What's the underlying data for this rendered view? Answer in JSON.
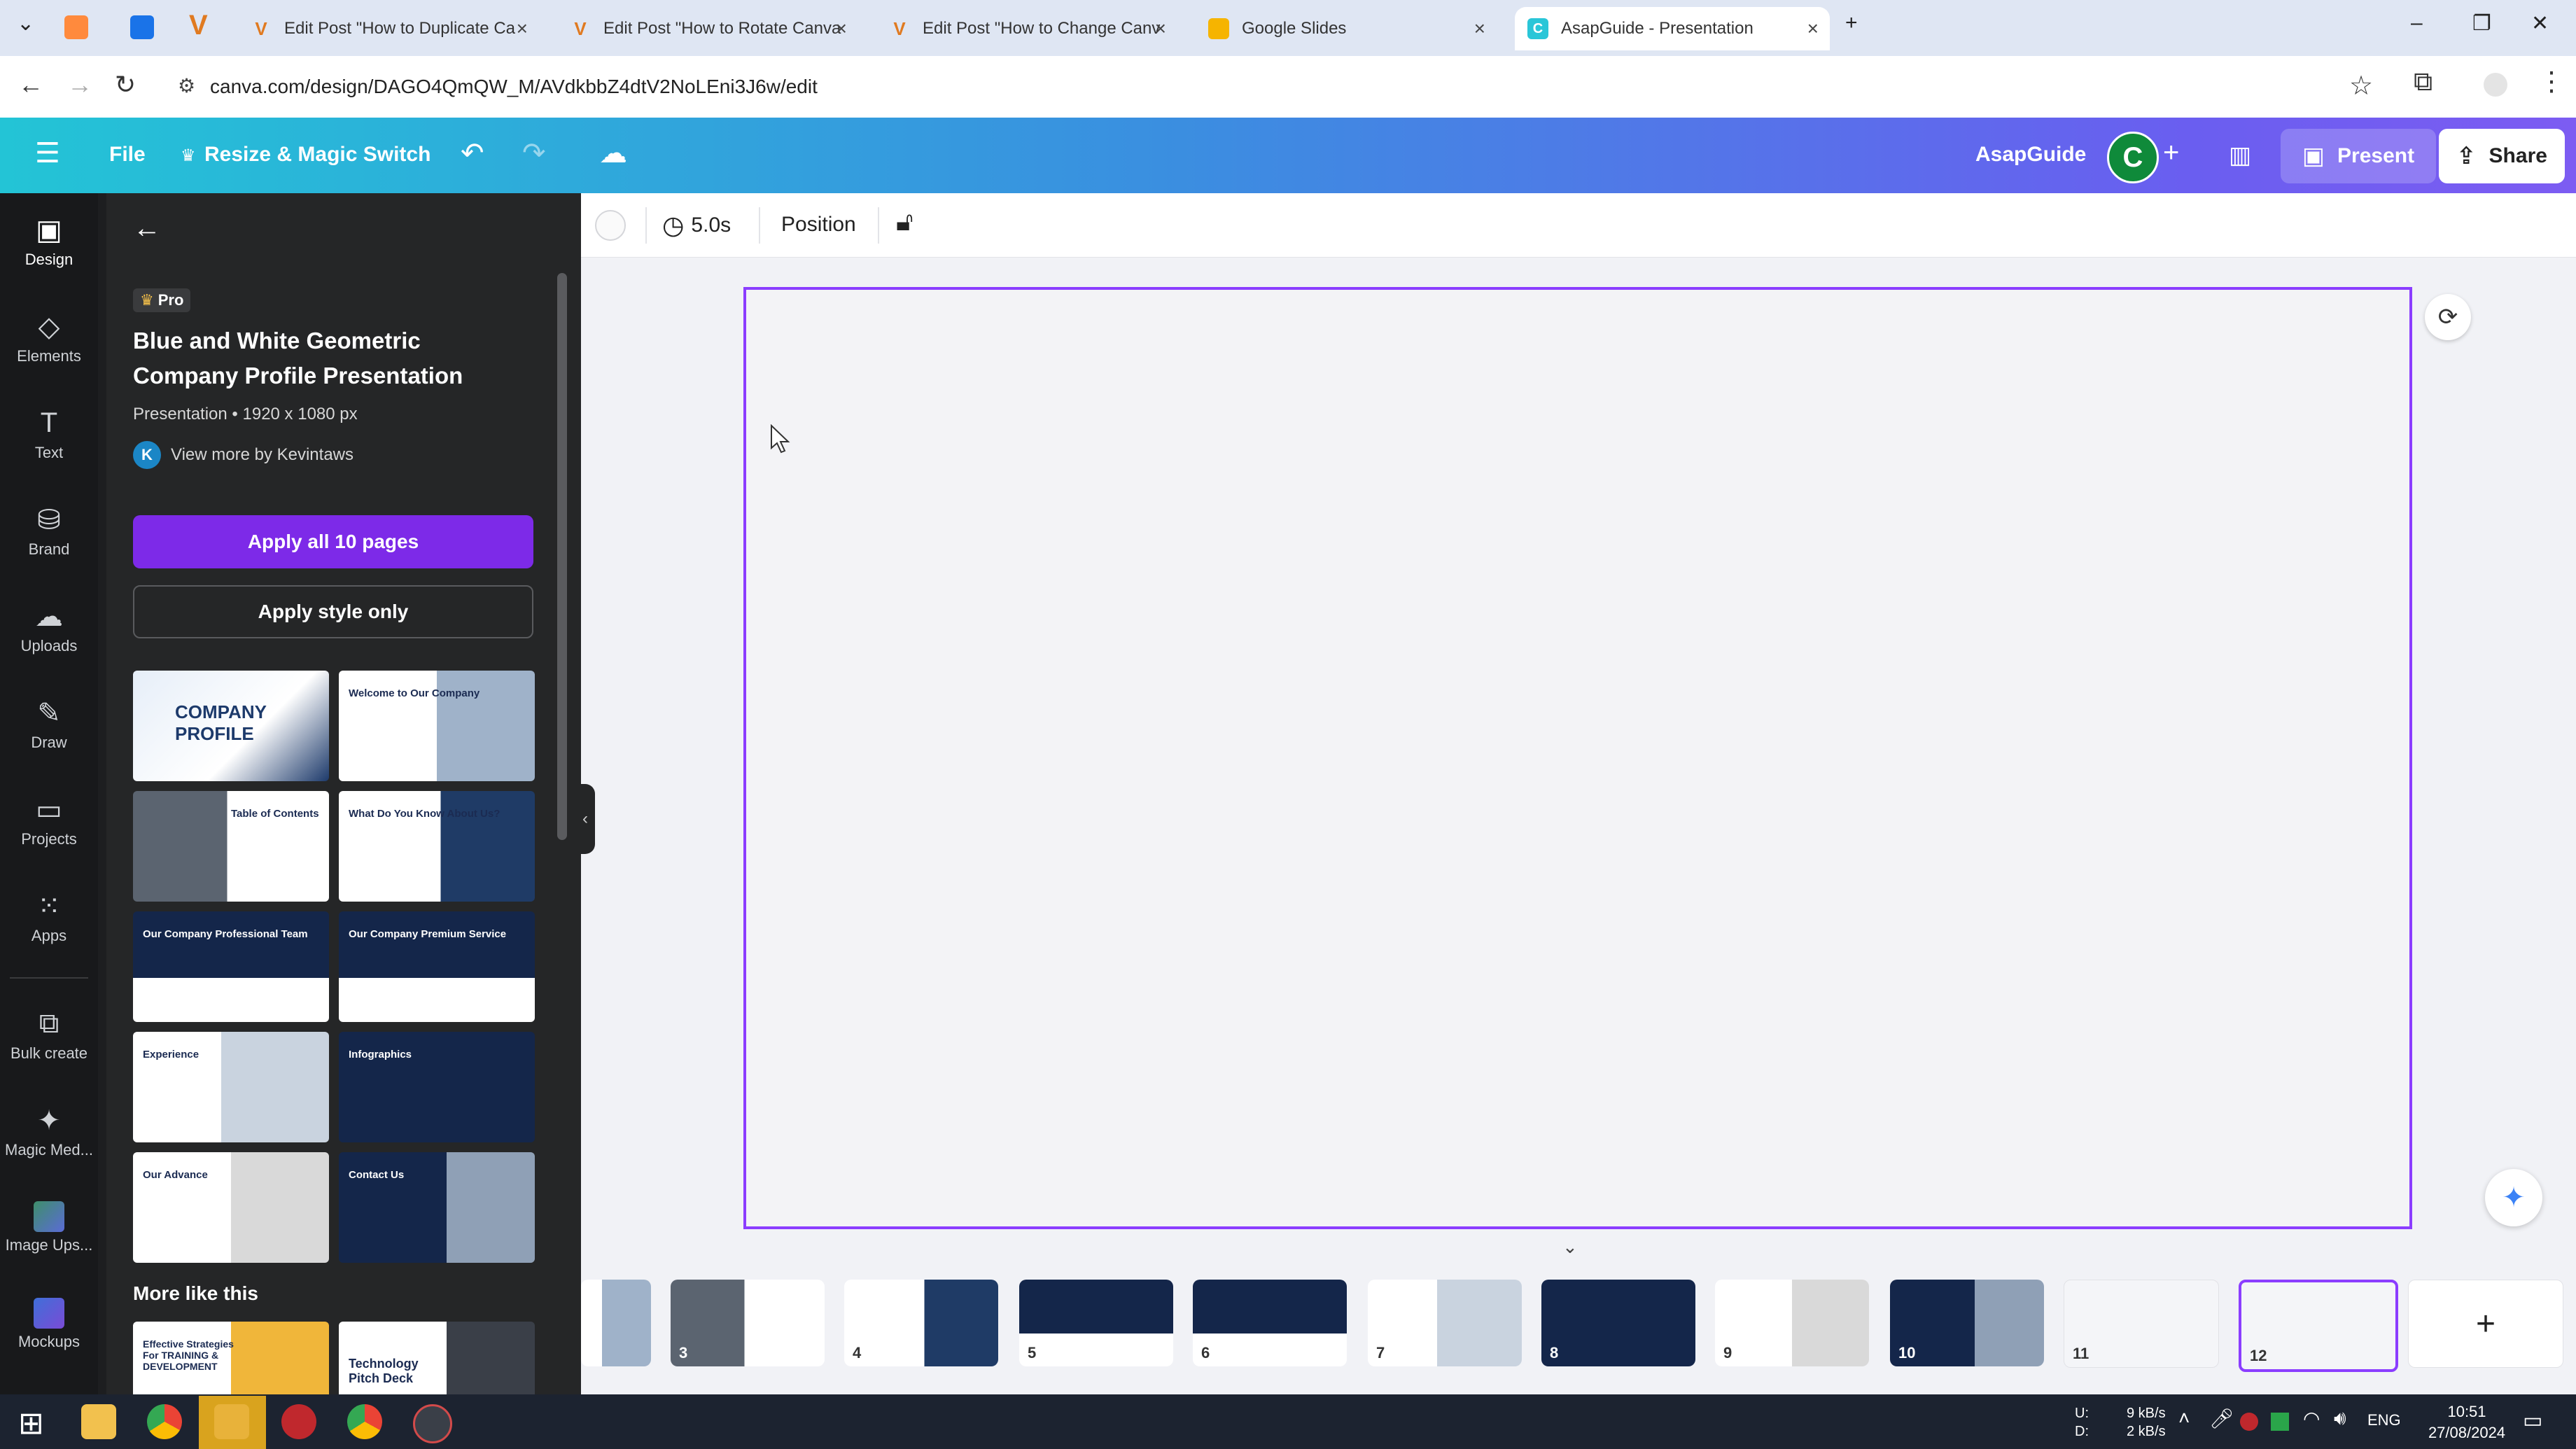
{
  "browser": {
    "tabs": [
      {
        "label": "Edit Post \"How to Duplicate Ca",
        "icon": "v-logo-icon"
      },
      {
        "label": "Edit Post \"How to Rotate Canva",
        "icon": "v-logo-icon"
      },
      {
        "label": "Edit Post \"How to Change Canv",
        "icon": "v-logo-icon"
      },
      {
        "label": "Google Slides",
        "icon": "google-slides-icon"
      },
      {
        "label": "AsapGuide - Presentation",
        "icon": "canva-icon"
      }
    ],
    "url": "canva.com/design/DAGO4QmQW_M/AVdkbbZ4dtV2NoLEni3J6w/edit"
  },
  "topbar": {
    "file_label": "File",
    "resize_label": "Resize & Magic Switch",
    "team_name": "AsapGuide",
    "avatar_letter": "C",
    "present_label": "Present",
    "share_label": "Share"
  },
  "rail": [
    {
      "label": "Design",
      "icon": "design-icon"
    },
    {
      "label": "Elements",
      "icon": "elements-icon"
    },
    {
      "label": "Text",
      "icon": "text-icon"
    },
    {
      "label": "Brand",
      "icon": "brand-icon"
    },
    {
      "label": "Uploads",
      "icon": "uploads-icon"
    },
    {
      "label": "Draw",
      "icon": "draw-icon"
    },
    {
      "label": "Projects",
      "icon": "projects-icon"
    },
    {
      "label": "Apps",
      "icon": "apps-icon"
    },
    {
      "label": "Bulk create",
      "icon": "bulk-create-icon"
    },
    {
      "label": "Magic Med...",
      "icon": "magic-media-icon"
    },
    {
      "label": "Image Ups...",
      "icon": "image-upscaler-icon"
    },
    {
      "label": "Mockups",
      "icon": "mockups-icon"
    }
  ],
  "panel": {
    "pro_badge": "Pro",
    "title": "Blue and White Geometric Company Profile Presentation",
    "meta": "Presentation • 1920 x 1080 px",
    "author_initial": "K",
    "author_link": "View more by Kevintaws",
    "apply_all_label": "Apply all 10 pages",
    "apply_style_label": "Apply style only",
    "more_like_this": "More like this",
    "templates": [
      {
        "title": "COMPANY PROFILE"
      },
      {
        "title": "Welcome to Our Company"
      },
      {
        "title": "Table of Contents"
      },
      {
        "title": "What Do You Know About Us?"
      },
      {
        "title": "Our Company Professional Team"
      },
      {
        "title": "Our Company Premium Service"
      },
      {
        "title": "Experience"
      },
      {
        "title": "Infographics"
      },
      {
        "title": "Our Advance"
      },
      {
        "title": "Contact Us"
      }
    ],
    "more": [
      {
        "title": "Effective Strategies For TRAINING & DEVELOPMENT"
      },
      {
        "title": "Technology Pitch Deck"
      }
    ]
  },
  "toolbar": {
    "duration": "5.0s",
    "position_label": "Position"
  },
  "pages": [
    {
      "num": "3"
    },
    {
      "num": "4"
    },
    {
      "num": "5"
    },
    {
      "num": "6"
    },
    {
      "num": "7"
    },
    {
      "num": "8"
    },
    {
      "num": "9"
    },
    {
      "num": "10"
    },
    {
      "num": "11"
    },
    {
      "num": "12"
    }
  ],
  "taskbar": {
    "net_up_label": "U:",
    "net_down_label": "D:",
    "net_up": "9 kB/s",
    "net_down": "2 kB/s",
    "lang": "ENG",
    "time": "10:51",
    "date": "27/08/2024"
  },
  "colors": {
    "accent": "#8b3dff",
    "panel_bg": "#252627",
    "rail_bg": "#18191b"
  }
}
